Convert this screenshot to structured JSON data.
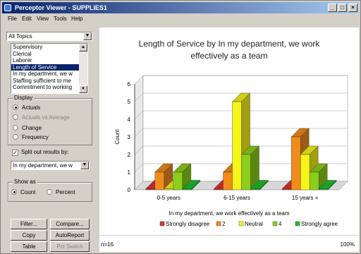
{
  "window": {
    "title": "Perceptor Viewer - SUPPLIES1"
  },
  "title_buttons": {
    "minimize": "_",
    "maximize": "□",
    "close": "×"
  },
  "menu": {
    "items": [
      "File",
      "Edit",
      "View",
      "Tools",
      "Help"
    ]
  },
  "topic_select": {
    "value": "All Topics"
  },
  "question_list": {
    "items": [
      "Supervisory",
      "Clerical",
      "Laborer",
      "Length of Service",
      "In my department, we w",
      "Staffing sufficient to me",
      "Commitment to working"
    ],
    "selected_index": 3
  },
  "display": {
    "title": "Display",
    "options": [
      "Actuals",
      "Actuals vs Average",
      "Change",
      "Frequency"
    ],
    "selected_index": 0,
    "disabled": [
      false,
      true,
      false,
      false
    ]
  },
  "split": {
    "label": "Split out results by:",
    "checked": true,
    "value": "In my department, we w"
  },
  "show_as": {
    "title": "Show as",
    "options": [
      "Count",
      "Percent"
    ],
    "selected_index": 0
  },
  "buttons": {
    "filter": "Filter...",
    "compare": "Compare...",
    "copy": "Copy",
    "autoreport": "AutoReport",
    "table": "Table",
    "pct_switch": "Pct Switch"
  },
  "status": {
    "n": "n=16",
    "zoom": "100%"
  },
  "chart_data": {
    "type": "bar",
    "title": "Length of Service by In my department, we work effectively as a team",
    "title_lines": [
      "Length of Service by In my department, we work",
      "effectively as a team"
    ],
    "categories": [
      "0-5 years",
      "6-15 years",
      "15 years +"
    ],
    "xlabel": "In my department, we work effectively as a team",
    "ylabel": "Count",
    "ylim": [
      0,
      6
    ],
    "yticks": [
      "0",
      "1",
      "2",
      "3",
      "4",
      "5",
      "6"
    ],
    "series": [
      {
        "name": "Strongly disagree",
        "color": "#e03030",
        "values": [
          0,
          0,
          0
        ]
      },
      {
        "name": "2",
        "color": "#f08c1c",
        "values": [
          1,
          1,
          3
        ]
      },
      {
        "name": "Neutral",
        "color": "#f5f519",
        "values": [
          0,
          5,
          2
        ]
      },
      {
        "name": "4",
        "color": "#8ccf1a",
        "values": [
          1,
          2,
          1
        ]
      },
      {
        "name": "Strongly agree",
        "color": "#1fbf2a",
        "values": [
          0,
          0,
          0
        ]
      }
    ],
    "legend": "bottom",
    "grid": true
  }
}
